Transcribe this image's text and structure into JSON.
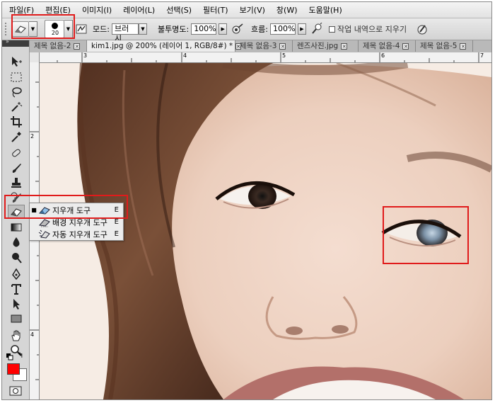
{
  "menu": [
    "파일(F)",
    "편집(E)",
    "이미지(I)",
    "레이어(L)",
    "선택(S)",
    "필터(T)",
    "보기(V)",
    "창(W)",
    "도움말(H)"
  ],
  "options": {
    "brush_size": "20",
    "mode_label": "모드:",
    "mode_value": "브러시",
    "opacity_label": "불투명도:",
    "opacity_value": "100%",
    "flow_label": "흐름:",
    "flow_value": "100%",
    "erase_history_label": "작업 내역으로 지우기"
  },
  "tabs": [
    {
      "label": "제목 없음-2",
      "active": false
    },
    {
      "label": "kim1.jpg @ 200% (레이어 1, RGB/8#) *",
      "active": true
    },
    {
      "label": "제목 없음-3",
      "active": false
    },
    {
      "label": "렌즈사진.jpg",
      "active": false
    },
    {
      "label": "제목 없음-4",
      "active": false
    },
    {
      "label": "제목 없음-5",
      "active": false
    }
  ],
  "ruler_h": [
    "3",
    "4",
    "5",
    "6",
    "7"
  ],
  "ruler_v": [
    "2",
    "3",
    "4"
  ],
  "flyout": {
    "items": [
      {
        "label": "지우개 도구",
        "key": "E",
        "selected": true
      },
      {
        "label": "배경 지우개 도구",
        "key": "E",
        "selected": false
      },
      {
        "label": "자동 지우개 도구",
        "key": "E",
        "selected": false
      }
    ]
  },
  "colors": {
    "foreground": "#ff0000",
    "background": "#ffffff",
    "highlight": "#e01b1b"
  }
}
